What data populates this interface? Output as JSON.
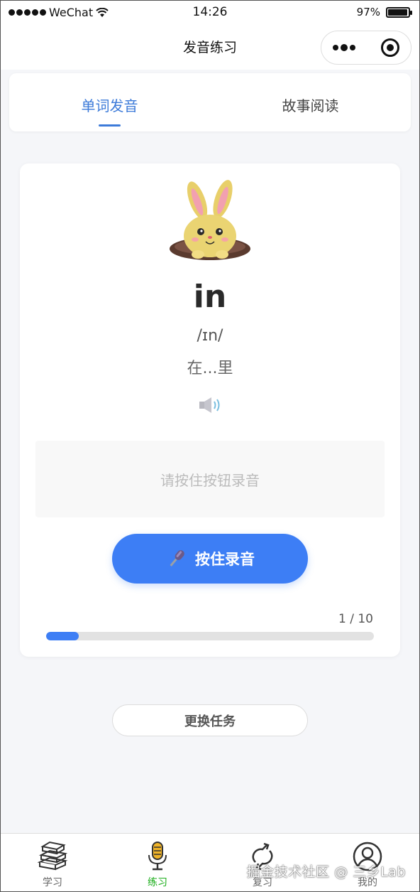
{
  "status_bar": {
    "carrier": "WeChat",
    "time": "14:26",
    "battery": "97%"
  },
  "nav": {
    "title": "发音练习"
  },
  "tabs": [
    {
      "label": "单词发音",
      "active": true
    },
    {
      "label": "故事阅读",
      "active": false
    }
  ],
  "card": {
    "word": "in",
    "phonetic": "/ɪn/",
    "meaning": "在...里",
    "record_placeholder": "请按住按钮录音",
    "record_button": "按住录音",
    "progress": {
      "text": "1 / 10",
      "current": 1,
      "total": 10
    }
  },
  "change_task_button": "更换任务",
  "tab_bar": [
    {
      "label": "学习",
      "icon": "books-icon",
      "active": false
    },
    {
      "label": "练习",
      "icon": "microphone-icon",
      "active": true
    },
    {
      "label": "复习",
      "icon": "repeat-icon",
      "active": false
    },
    {
      "label": "我的",
      "icon": "user-icon",
      "active": false
    }
  ],
  "watermark": "掘金技术社区 @ 三乡Lab",
  "colors": {
    "accent": "#3d7ef5",
    "tab_active": "#3d7bd9",
    "tabbar_active": "#1aad19"
  }
}
